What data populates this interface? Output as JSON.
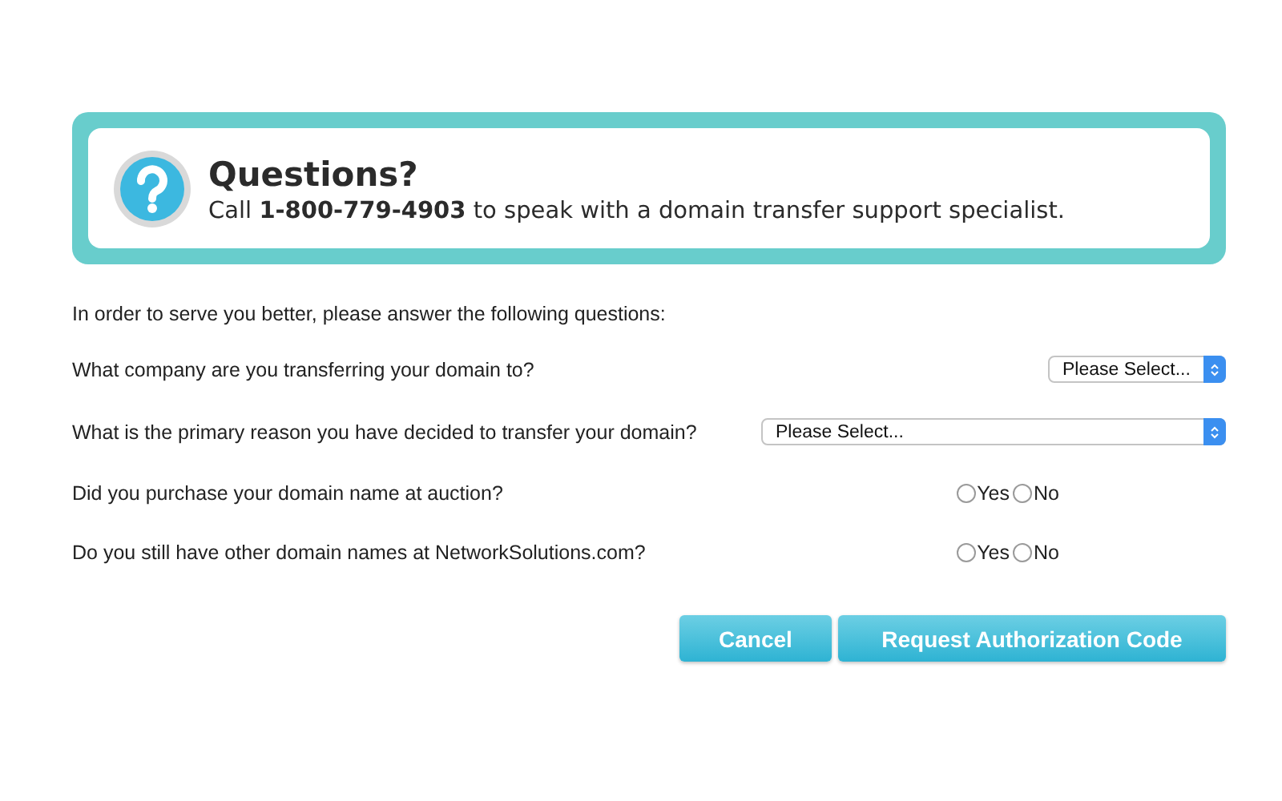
{
  "banner": {
    "title": "Questions?",
    "text": "Call **1-800-779-4903** to speak with a domain transfer support specialist."
  },
  "intro": "In order to serve you better, please answer the following questions:",
  "questions": [
    {
      "kind": "select",
      "label": "What company are you transferring your domain to?",
      "value": "Please Select..."
    },
    {
      "kind": "longselect",
      "label": "What is the primary reason you have decided to transfer your domain?",
      "value": "Please Select..."
    },
    {
      "kind": "radio",
      "label": "Did you purchase your domain name at auction?",
      "options": [
        {
          "label": "Yes",
          "selected": false
        },
        {
          "label": "No",
          "selected": false
        }
      ]
    },
    {
      "kind": "radio",
      "label": "Do you still have other domain names at NetworkSolutions.com?",
      "options": [
        {
          "label": "Yes",
          "selected": false
        },
        {
          "label": "No",
          "selected": false
        }
      ]
    }
  ],
  "buttons": [
    "Cancel",
    "Request Authorization Code"
  ]
}
